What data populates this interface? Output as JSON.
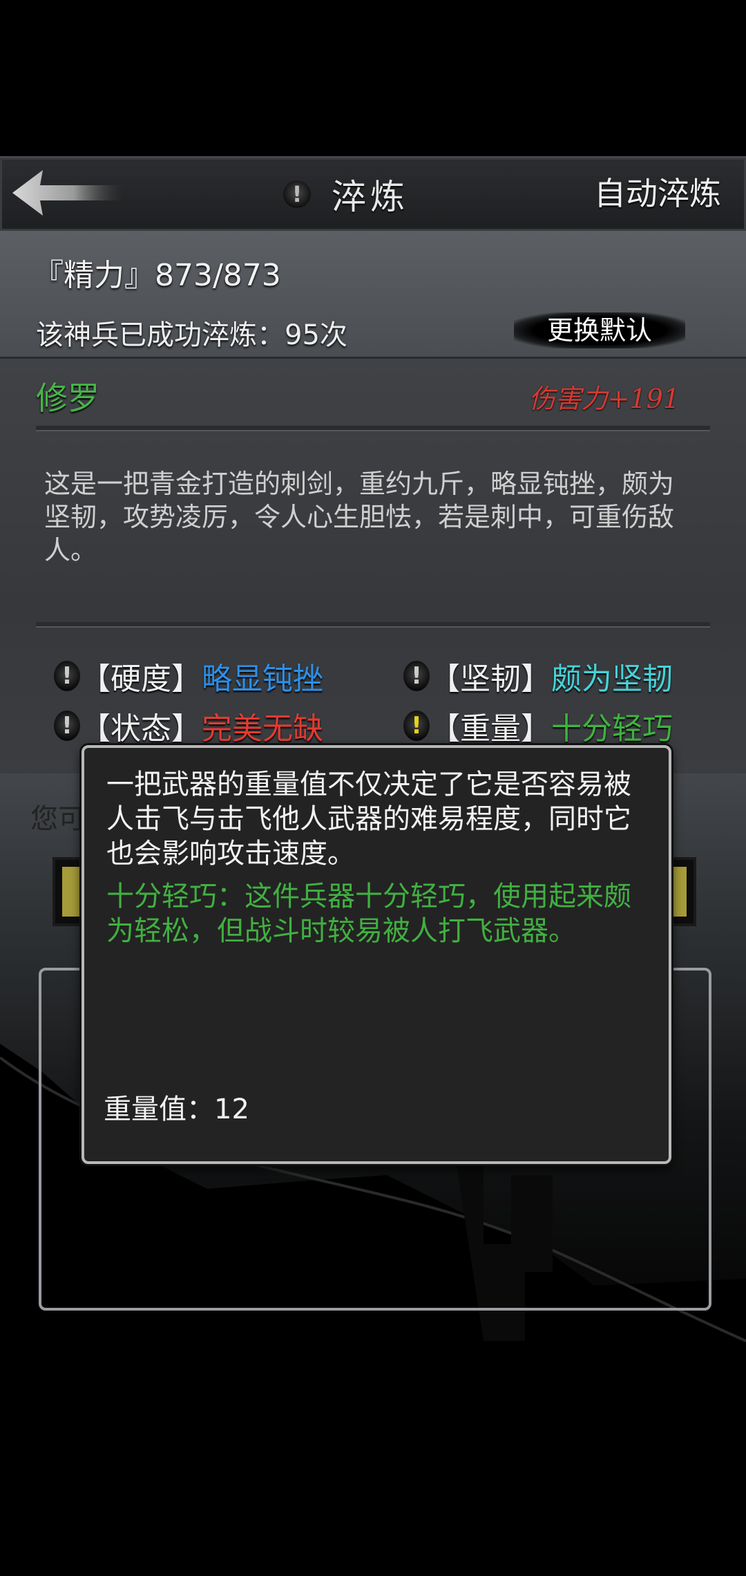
{
  "header": {
    "title": "淬炼",
    "auto_refine_label": "自动淬炼",
    "back_icon": "back-arrow-icon",
    "info_icon": "exclamation-icon"
  },
  "player": {
    "stamina": "『精力』873/873",
    "refine_count": "该神兵已成功淬炼：95次",
    "change_default_label": "更换默认"
  },
  "weapon": {
    "name": "修罗",
    "damage": "伤害力+191",
    "description": "这是一把青金打造的刺剑，重约九斤，略显钝挫，颇为坚韧，攻势凌厉，令人心生胆怯，若是刺中，可重伤敌人。",
    "attributes": [
      {
        "key": "【硬度】",
        "value": "略显钝挫",
        "color": "#2e8fe8",
        "icon": "exclamation-icon",
        "highlight": false
      },
      {
        "key": "【坚韧】",
        "value": "颇为坚韧",
        "color": "#46d2d8",
        "icon": "exclamation-icon",
        "highlight": false
      },
      {
        "key": "【状态】",
        "value": "完美无缺",
        "color": "#e23b32",
        "icon": "exclamation-icon",
        "highlight": false
      },
      {
        "key": "【重量】",
        "value": "十分轻巧",
        "color": "#3fb43f",
        "icon": "exclamation-icon",
        "highlight": true
      }
    ]
  },
  "background_hint": "您可",
  "tooltip": {
    "description": "一把武器的重量值不仅决定了它是否容易被人击飞与击飞他人武器的难易程度，同时它也会影响攻击速度。",
    "detail": "十分轻巧：这件兵器十分轻巧，使用起来颇为轻松，但战斗时较易被人打飞武器。",
    "value_label": "重量值：",
    "value": "12"
  }
}
